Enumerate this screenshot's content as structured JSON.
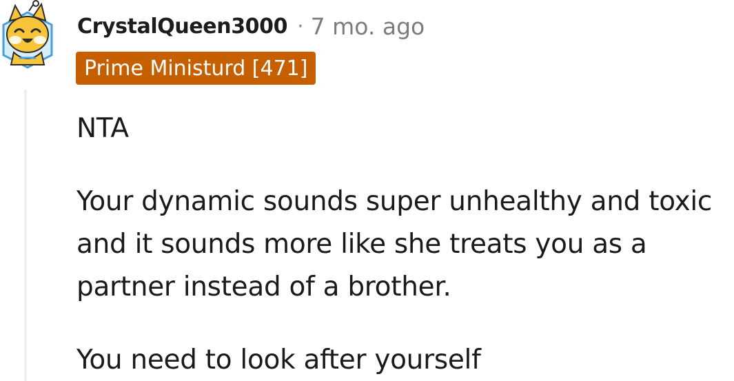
{
  "comment": {
    "username": "CrystalQueen3000",
    "separator": "·",
    "timestamp": "7 mo. ago",
    "flair": "Prime Ministurd [471]",
    "paragraphs": [
      "NTA",
      "Your dynamic sounds super unhealthy and toxic and it sounds more like she treats you as a partner instead of a brother.",
      "You need to look after yourself"
    ]
  },
  "colors": {
    "flair_background": "#c65f00",
    "avatar_yellow": "#f8c43a",
    "avatar_frame_blue": "#4a9fd6"
  },
  "icons": {
    "avatar": "snoo-avatar-icon"
  }
}
